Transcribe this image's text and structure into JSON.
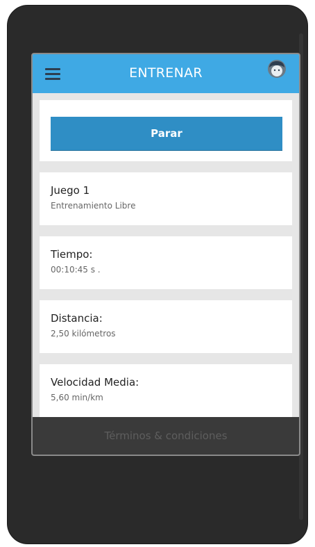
{
  "header": {
    "title": "ENTRENAR",
    "menu_icon": "hamburger-menu-icon",
    "avatar_icon": "user-avatar-icon"
  },
  "actions": {
    "stop_label": "Parar"
  },
  "stats": [
    {
      "label": "Juego 1",
      "value": "Entrenamiento Libre"
    },
    {
      "label": "Tiempo:",
      "value": "00:10:45 s ."
    },
    {
      "label": "Distancia:",
      "value": "2,50 kilómetros"
    },
    {
      "label": "Velocidad Media:",
      "value": "5,60 min/km"
    }
  ],
  "footer": {
    "terms_link": "Términos & condiciones"
  },
  "colors": {
    "header_bg": "#3fa9e4",
    "button_bg": "#2f8ec5",
    "footer_bg": "#3a3a3a",
    "device_bg": "#2a2a2a"
  }
}
